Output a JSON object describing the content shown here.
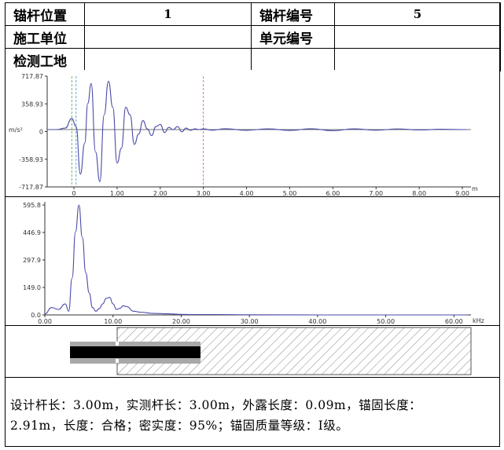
{
  "info_table": {
    "anchor_position_label": "锚杆位置",
    "anchor_position_value": "1",
    "anchor_number_label": "锚杆编号",
    "anchor_number_value": "5",
    "construction_unit_label": "施工单位",
    "construction_unit_value": "",
    "unit_number_label": "单元编号",
    "unit_number_value": "",
    "test_site_label": "检测工地",
    "test_site_value": ""
  },
  "time_chart": {
    "ylabel": "m/s²",
    "x_unit": "m",
    "y_ticks": [
      "717.87",
      "358.93",
      "0",
      "-358.93",
      "-717.87"
    ],
    "x_ticks": [
      "0",
      "1.00",
      "2.00",
      "3.00",
      "4.00",
      "5.00",
      "6.00",
      "7.00",
      "8.00",
      "9.00"
    ],
    "markers": [
      {
        "x": -0.05,
        "color": "#44aa44"
      },
      {
        "x": 0.05,
        "color": "#3f8fdc"
      },
      {
        "x": 3.0,
        "color": "#e05555"
      }
    ],
    "line_color": "#4a4aa8"
  },
  "freq_chart": {
    "x_unit": "kHz",
    "y_ticks": [
      "595.8",
      "446.9",
      "297.9",
      "149.0",
      "0.0"
    ],
    "x_ticks": [
      "0.00",
      "10.00",
      "20.00",
      "30.00",
      "40.00",
      "50.00",
      "60.00"
    ],
    "line_color": "#4a4aa8"
  },
  "chart_data": [
    {
      "type": "line",
      "xlabel": "m",
      "ylabel": "m/s²",
      "xlim": [
        -0.62,
        9.2
      ],
      "ylim": [
        -717.87,
        717.87
      ],
      "x": [
        -0.6,
        -0.4,
        -0.2,
        -0.05,
        0.05,
        0.15,
        0.25,
        0.32,
        0.4,
        0.5,
        0.6,
        0.7,
        0.8,
        0.9,
        1.0,
        1.1,
        1.2,
        1.3,
        1.4,
        1.5,
        1.6,
        1.7,
        1.8,
        1.9,
        2.0,
        2.1,
        2.2,
        2.3,
        2.4,
        2.5,
        2.6,
        2.7,
        2.8,
        2.9,
        3.0,
        3.2,
        3.5,
        4.0,
        4.5,
        5.0,
        5.5,
        6.0,
        6.5,
        7.0,
        7.5,
        8.0,
        8.5,
        9.0,
        9.1
      ],
      "y": [
        0,
        0,
        20,
        150,
        40,
        -600,
        -180,
        350,
        620,
        -300,
        -700,
        200,
        650,
        300,
        -450,
        -250,
        300,
        200,
        -200,
        -60,
        120,
        10,
        -80,
        40,
        70,
        -40,
        30,
        0,
        40,
        -30,
        20,
        -10,
        10,
        0,
        10,
        -8,
        12,
        -10,
        10,
        -12,
        12,
        -15,
        10,
        -8,
        8,
        -5,
        4,
        0,
        0
      ]
    },
    {
      "type": "line",
      "xlabel": "kHz",
      "ylabel": "",
      "xlim": [
        0,
        62.5
      ],
      "ylim": [
        0,
        595.8
      ],
      "x": [
        0,
        1,
        2,
        3,
        3.5,
        4,
        4.5,
        5,
        5.5,
        6,
        6.5,
        7,
        7.5,
        8,
        8.5,
        9,
        9.5,
        10,
        10.5,
        11,
        11.5,
        12,
        13,
        14,
        16,
        18,
        20,
        22,
        25,
        30,
        40,
        50,
        60,
        62
      ],
      "y": [
        5,
        40,
        30,
        60,
        20,
        200,
        450,
        595,
        420,
        230,
        120,
        40,
        20,
        35,
        60,
        90,
        95,
        60,
        30,
        35,
        50,
        45,
        20,
        15,
        8,
        6,
        3,
        2,
        2,
        1,
        0,
        0,
        0,
        0
      ]
    }
  ],
  "anchor_diagram": {
    "bar_color": "#000000",
    "sheath_color": "#a8a8a8",
    "hatch_color": "#888888"
  },
  "summary": {
    "line1": "设计杆长：3.00m，实测杆长：3.00m，外露长度：0.09m，锚固长度：",
    "line2": "2.91m，长度：合格；密实度：95%；锚固质量等级：Ⅰ级。"
  }
}
